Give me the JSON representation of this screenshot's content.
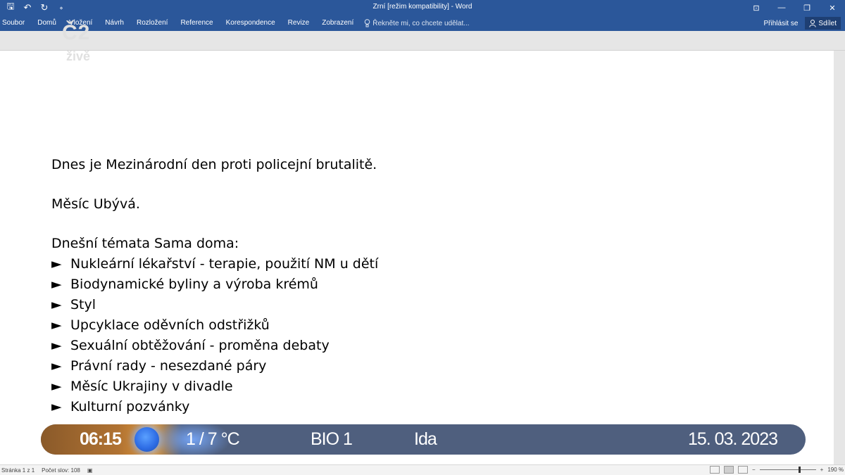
{
  "titlebar": {
    "title": "Zrní [režim kompatibility] - Word",
    "qat": {
      "save": "🖫",
      "undo": "↶",
      "redo": "↻",
      "more": "⋄"
    },
    "controls": {
      "ribbon_opts": "⊡",
      "minimize": "—",
      "restore": "❐",
      "close": "✕"
    }
  },
  "ribbon": {
    "tabs": [
      "Soubor",
      "Domů",
      "Vložení",
      "Návrh",
      "Rozložení",
      "Reference",
      "Korespondence",
      "Revize",
      "Zobrazení"
    ],
    "tell_me": "Řekněte mi, co chcete udělat...",
    "sign_in": "Přihlásit se",
    "share": "Sdílet"
  },
  "watermark": {
    "ct": "Č2",
    "zive": "živě"
  },
  "document": {
    "line1": "Dnes je Mezinárodní den proti policejní brutalitě.",
    "line2": "Měsíc Ubývá.",
    "topics_heading": "Dnešní témata Sama doma:",
    "bullet_glyph": "►",
    "topics": [
      "Nukleární lékařství - terapie, použití NM u dětí",
      "Biodynamické byliny a výroba krémů",
      "Styl",
      "Upcyklace oděvních odstřižků",
      "Sexuální obtěžování - proměna debaty",
      "Právní rady - nesezdané páry",
      "Měsíc Ukrajiny v divadle",
      "Kulturní pozvánky"
    ]
  },
  "ticker": {
    "time": "06:15",
    "temperature": "1 / 7 °C",
    "channel": "BIO 1",
    "name_day": "Ida",
    "date": "15. 03. 2023"
  },
  "statusbar": {
    "page": "Stránka 1 z 1",
    "words": "Počet slov: 108",
    "zoom": "190 %"
  }
}
